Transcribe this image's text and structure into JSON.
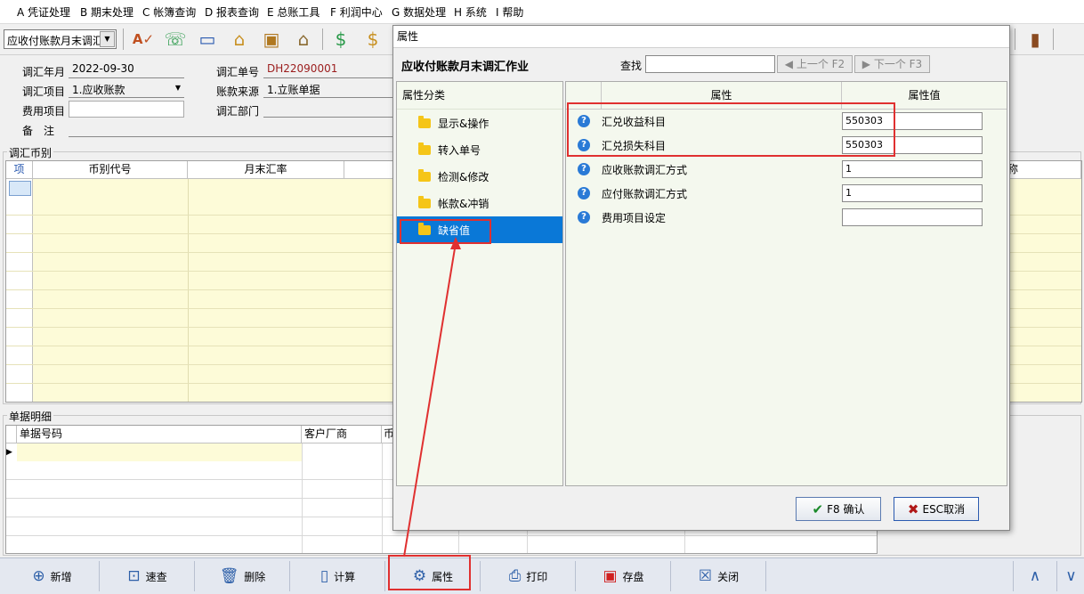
{
  "menu": [
    "A 凭证处理",
    "B 期末处理",
    "C 帐簿查询",
    "D 报表查询",
    "E 总账工具",
    "F 利润中心",
    "G 数据处理",
    "H 系统",
    "I 帮助"
  ],
  "toolbar": {
    "combo_value": "应收付账款月末调汇"
  },
  "form": {
    "adj_month_label": "调汇年月",
    "adj_month_value": "2022-09-30",
    "adj_no_label": "调汇单号",
    "adj_no_value": "DH22090001",
    "adj_item_label": "调汇项目",
    "adj_item_value": "1.应收账款",
    "source_label": "账款来源",
    "source_value": "1.立账单据",
    "expense_label": "费用项目",
    "dept_label": "调汇部门",
    "remark_label": "备　注"
  },
  "currency_group": {
    "label": "调汇币别",
    "cols": [
      "项",
      "币别代号",
      "月末汇率"
    ],
    "extra_col": "称"
  },
  "detail_group": {
    "label": "单据明细",
    "cols": [
      "单据号码",
      "客户厂商",
      "币"
    ]
  },
  "bottom_buttons": [
    "新增",
    "速查",
    "删除",
    "计算",
    "属性",
    "打印",
    "存盘",
    "关闭"
  ],
  "dialog": {
    "title": "属性",
    "heading": "应收付账款月末调汇作业",
    "search_label": "查找",
    "prev_btn": "上一个 F2",
    "next_btn": "下一个 F3",
    "cat_header": "属性分类",
    "categories": [
      "显示&操作",
      "转入单号",
      "检测&修改",
      "帐款&冲销",
      "缺省值"
    ],
    "prop_header": "属性",
    "value_header": "属性值",
    "props": [
      {
        "name": "汇兑收益科目",
        "value": "550303"
      },
      {
        "name": "汇兑损失科目",
        "value": "550303"
      },
      {
        "name": "应收账款调汇方式",
        "value": "1"
      },
      {
        "name": "应付账款调汇方式",
        "value": "1"
      },
      {
        "name": "费用项目设定",
        "value": ""
      }
    ],
    "ok_btn": "F8 确认",
    "cancel_btn": "ESC取消"
  },
  "colors": {
    "selected_cat": "#0a78d7",
    "annotation": "#e03030",
    "grid_yellow": "#fdfbd8",
    "accent_red": "#9b1c1c"
  }
}
